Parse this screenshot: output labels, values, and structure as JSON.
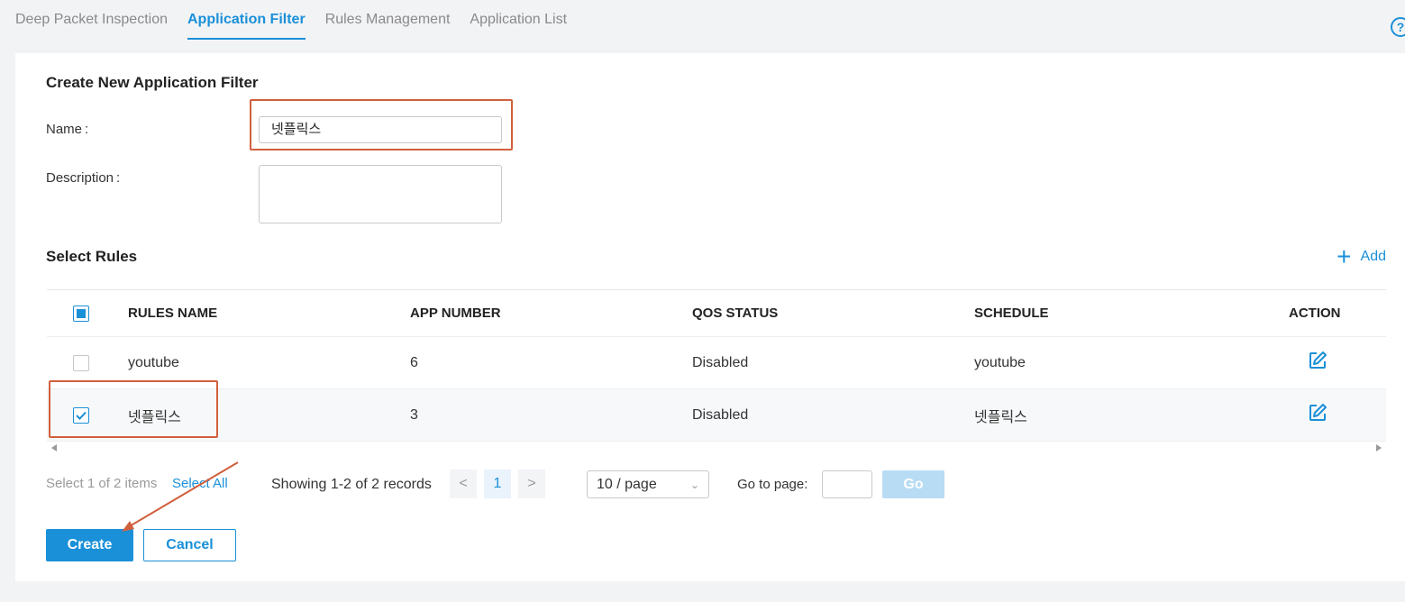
{
  "tabs": [
    {
      "label": "Deep Packet Inspection",
      "active": false
    },
    {
      "label": "Application Filter",
      "active": true
    },
    {
      "label": "Rules Management",
      "active": false
    },
    {
      "label": "Application List",
      "active": false
    }
  ],
  "help_icon": "question-circle-icon",
  "form": {
    "title": "Create New Application Filter",
    "name_label": "Name",
    "name_value": "넷플릭스",
    "description_label": "Description",
    "description_value": ""
  },
  "rules": {
    "title": "Select Rules",
    "add_label": "Add",
    "columns": [
      "RULES NAME",
      "APP NUMBER",
      "QOS STATUS",
      "SCHEDULE",
      "ACTION"
    ],
    "rows": [
      {
        "name": "youtube",
        "app_number": "6",
        "qos_status": "Disabled",
        "schedule": "youtube",
        "checked": false
      },
      {
        "name": "넷플릭스",
        "app_number": "3",
        "qos_status": "Disabled",
        "schedule": "넷플릭스",
        "checked": true
      }
    ]
  },
  "pager": {
    "selection_text": "Select 1 of 2 items",
    "select_all_label": "Select All",
    "showing_text": "Showing 1-2 of 2 records",
    "prev": "<",
    "current_page": "1",
    "next": ">",
    "per_page": "10 / page",
    "goto_label": "Go to page:",
    "go_label": "Go"
  },
  "actions": {
    "create_label": "Create",
    "cancel_label": "Cancel"
  },
  "colors": {
    "accent": "#1a90d8",
    "annotation": "#d1603d"
  }
}
